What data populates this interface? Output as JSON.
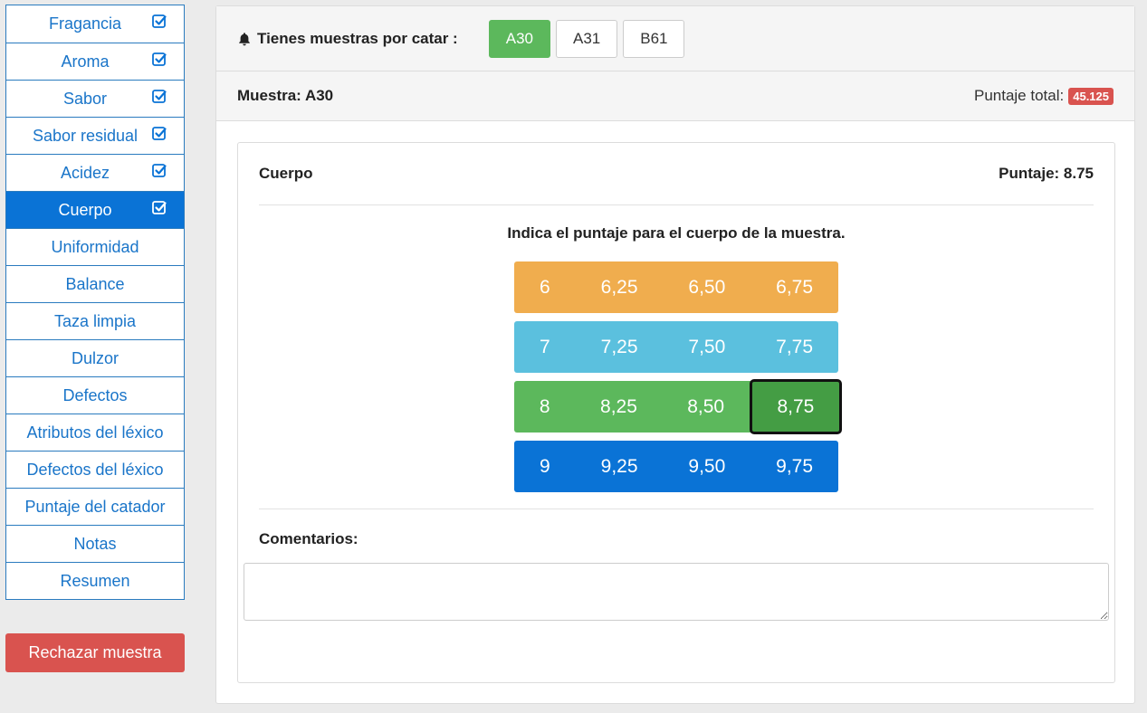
{
  "sidebar": {
    "items": [
      {
        "label": "Fragancia",
        "checked": true,
        "active": false
      },
      {
        "label": "Aroma",
        "checked": true,
        "active": false
      },
      {
        "label": "Sabor",
        "checked": true,
        "active": false
      },
      {
        "label": "Sabor residual",
        "checked": true,
        "active": false
      },
      {
        "label": "Acidez",
        "checked": true,
        "active": false
      },
      {
        "label": "Cuerpo",
        "checked": true,
        "active": true
      },
      {
        "label": "Uniformidad",
        "checked": false,
        "active": false
      },
      {
        "label": "Balance",
        "checked": false,
        "active": false
      },
      {
        "label": "Taza limpia",
        "checked": false,
        "active": false
      },
      {
        "label": "Dulzor",
        "checked": false,
        "active": false
      },
      {
        "label": "Defectos",
        "checked": false,
        "active": false
      },
      {
        "label": "Atributos del léxico",
        "checked": false,
        "active": false
      },
      {
        "label": "Defectos del léxico",
        "checked": false,
        "active": false
      },
      {
        "label": "Puntaje del catador",
        "checked": false,
        "active": false
      },
      {
        "label": "Notas",
        "checked": false,
        "active": false
      },
      {
        "label": "Resumen",
        "checked": false,
        "active": false
      }
    ],
    "reject_label": "Rechazar muestra"
  },
  "topbar": {
    "bell_icon": "bell-icon",
    "text": "Tienes muestras por catar :",
    "samples": [
      {
        "label": "A30",
        "active": true
      },
      {
        "label": "A31",
        "active": false
      },
      {
        "label": "B61",
        "active": false
      }
    ]
  },
  "infobar": {
    "sample_title": "Muestra: A30",
    "total_label": "Puntaje total:",
    "total_value": "45.125"
  },
  "card": {
    "title": "Cuerpo",
    "score": "Puntaje: 8.75",
    "instruction": "Indica el puntaje para el cuerpo de la muestra.",
    "rows": [
      {
        "color": "#f0ad4e",
        "values": [
          "6",
          "6,25",
          "6,50",
          "6,75"
        ]
      },
      {
        "color": "#5bc0de",
        "values": [
          "7",
          "7,25",
          "7,50",
          "7,75"
        ]
      },
      {
        "color": "#5cb85c",
        "values": [
          "8",
          "8,25",
          "8,50",
          "8,75"
        ]
      },
      {
        "color": "#0a73d6",
        "values": [
          "9",
          "9,25",
          "9,50",
          "9,75"
        ]
      }
    ],
    "selected": "8,75",
    "comments_label": "Comentarios:",
    "comments_value": ""
  },
  "colors": {
    "accent": "#0a73d6",
    "success": "#5cb85c",
    "danger": "#d9534f"
  }
}
